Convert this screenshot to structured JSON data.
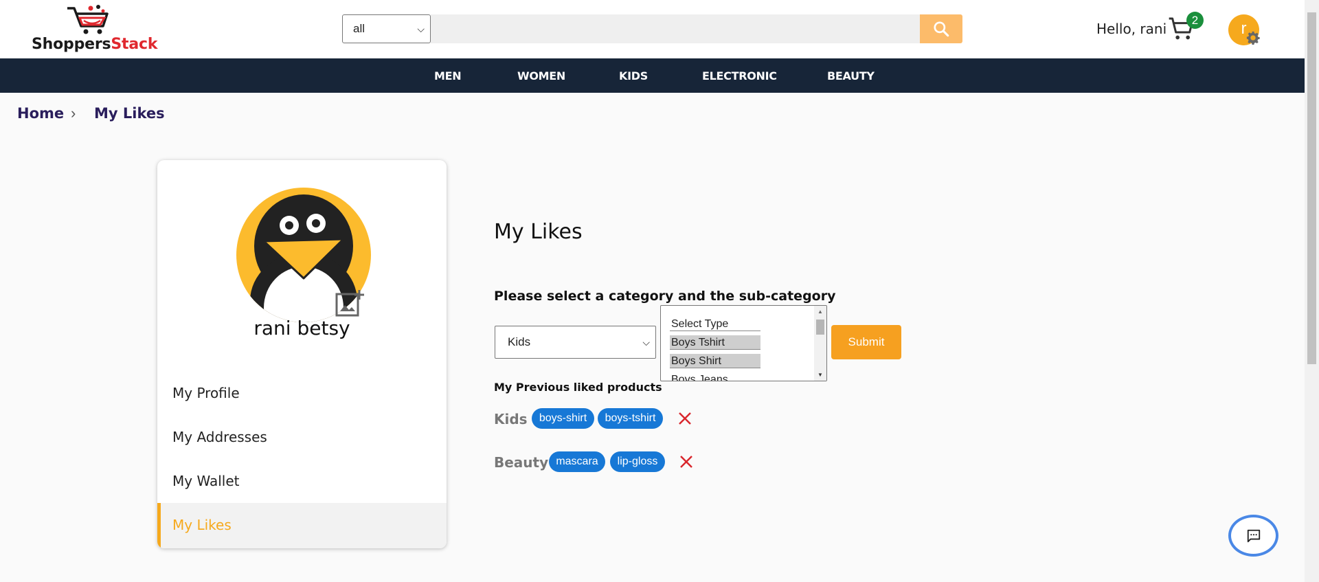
{
  "brand": {
    "name_part1": "Shoppers",
    "name_part2": "Stack"
  },
  "search": {
    "category_value": "all",
    "query_value": "",
    "button_icon": "search-icon"
  },
  "user": {
    "greeting": "Hello, rani",
    "cart_count": "2",
    "avatar_initial": "r",
    "full_name": "rani betsy"
  },
  "nav": {
    "items": [
      "MEN",
      "WOMEN",
      "KIDS",
      "ELECTRONIC",
      "BEAUTY"
    ]
  },
  "breadcrumb": {
    "home": "Home",
    "current": "My Likes"
  },
  "sidebar": {
    "items": [
      "My Profile",
      "My Addresses",
      "My Wallet",
      "My Likes"
    ],
    "active": "My Likes"
  },
  "likes": {
    "title": "My Likes",
    "instruction": "Please select a category and the sub-category",
    "category_value": "Kids",
    "subcategory_options": [
      "Select Type",
      "Boys Tshirt",
      "Boys Shirt",
      "Boys Jeans"
    ],
    "submit_label": "Submit",
    "previous_label": "My Previous liked products",
    "rows": [
      {
        "category": "Kids :",
        "tags": [
          "boys-shirt",
          "boys-tshirt"
        ]
      },
      {
        "category": "Beauty :",
        "tags": [
          "mascara",
          "lip-gloss"
        ]
      }
    ]
  },
  "colors": {
    "accent": "#f6a91d",
    "nav_bg": "#172538",
    "chip": "#1778d6",
    "delete": "#d9262c"
  }
}
